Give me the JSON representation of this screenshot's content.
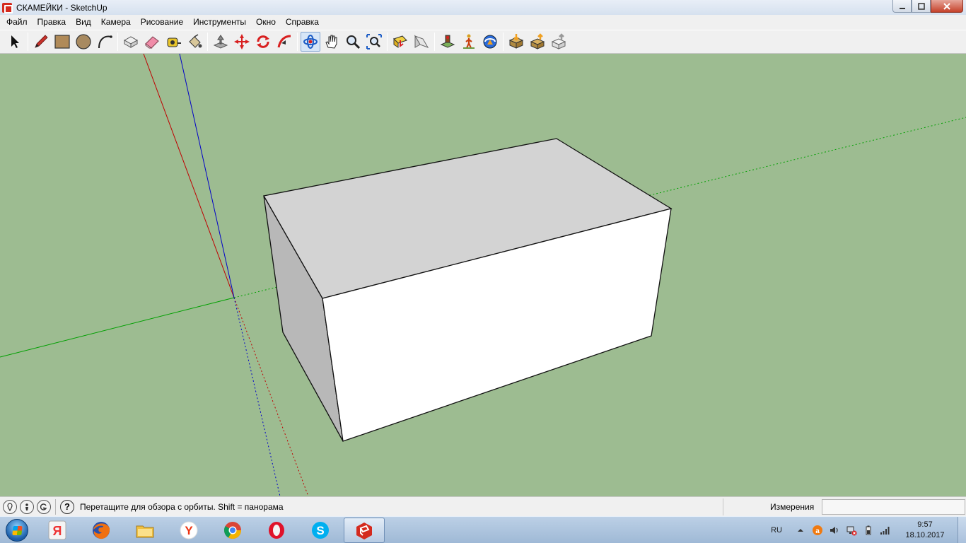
{
  "window": {
    "title": "СКАМЕЙКИ - SketchUp",
    "app_icon": "sketchup-icon",
    "controls": [
      "minimize-icon",
      "maximize-icon",
      "close-icon"
    ]
  },
  "menu": {
    "items": [
      {
        "label": "Файл"
      },
      {
        "label": "Правка"
      },
      {
        "label": "Вид"
      },
      {
        "label": "Камера"
      },
      {
        "label": "Рисование"
      },
      {
        "label": "Инструменты"
      },
      {
        "label": "Окно"
      },
      {
        "label": "Справка"
      }
    ]
  },
  "toolbar": {
    "tools": [
      "select-tool-icon",
      "pencil-line-tool-icon",
      "rectangle-tool-icon",
      "circle-tool-icon",
      "arc-tool-icon",
      "make-component-icon",
      "eraser-icon",
      "tape-measure-icon",
      "paint-bucket-icon",
      "push-pull-icon",
      "move-icon",
      "rotate-icon",
      "follow-me-icon",
      "orbit-icon",
      "pan-icon",
      "zoom-icon",
      "zoom-extents-icon",
      "section-plane-icon",
      "display-section-icon",
      "position-camera-icon",
      "walk-icon",
      "look-around-icon",
      "get-models-icon",
      "share-model-icon",
      "share-component-icon"
    ],
    "active_tool": "orbit-icon"
  },
  "viewport": {
    "background_color": "#9dbc91",
    "axis_colors": {
      "red": "#c00000",
      "green": "#00a000",
      "blue": "#0000c8"
    },
    "face_colors": {
      "top": "#d3d3d3",
      "side": "#b8b8b8",
      "front": "#ffffff"
    }
  },
  "status": {
    "icons": [
      "geolocation-icon",
      "credit-icon",
      "sign-in-icon"
    ],
    "help_symbol": "?",
    "message": "Перетащите для обзора с орбиты.  Shift = панорама",
    "measurements_label": "Измерения",
    "measurements_value": ""
  },
  "taskbar": {
    "apps": [
      {
        "name": "yandex-launcher-icon",
        "color": "#e33",
        "letter": "Я"
      },
      {
        "name": "firefox-icon"
      },
      {
        "name": "file-explorer-icon"
      },
      {
        "name": "yandex-browser-icon",
        "letter": "Y"
      },
      {
        "name": "chrome-icon"
      },
      {
        "name": "opera-icon"
      },
      {
        "name": "skype-icon"
      },
      {
        "name": "sketchup-task-icon",
        "active": true
      }
    ],
    "tray": {
      "language": "RU",
      "icons": [
        "avast-icon",
        "volume-icon",
        "network-error-icon",
        "battery-icon",
        "signal-icon"
      ],
      "time": "9:57",
      "date": "18.10.2017"
    }
  }
}
